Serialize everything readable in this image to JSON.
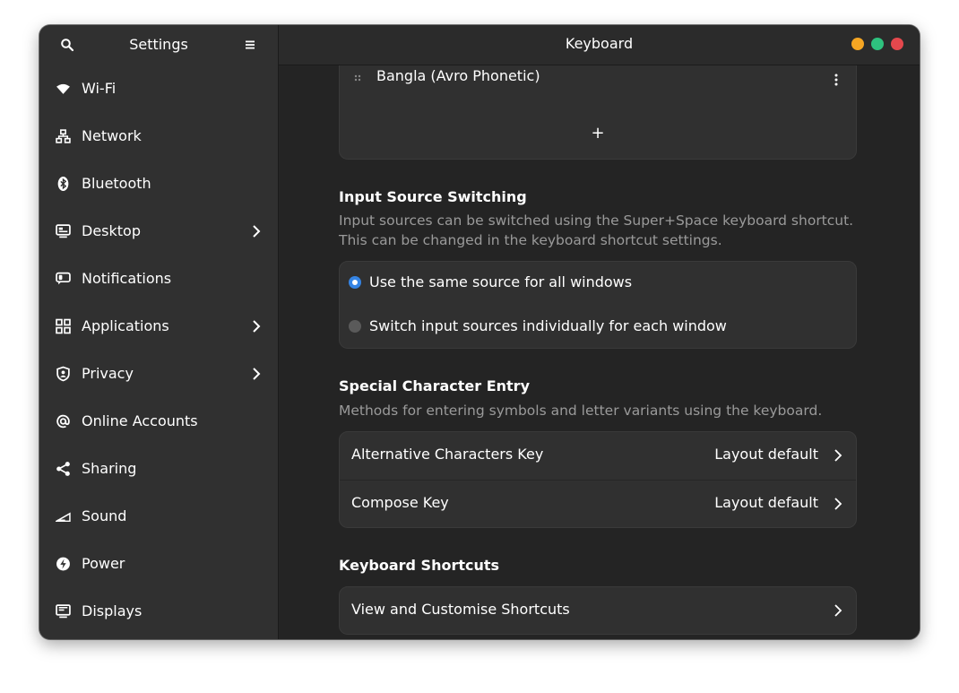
{
  "sidebar": {
    "title": "Settings",
    "items": [
      {
        "label": "Wi-Fi"
      },
      {
        "label": "Network"
      },
      {
        "label": "Bluetooth"
      },
      {
        "label": "Desktop"
      },
      {
        "label": "Notifications"
      },
      {
        "label": "Applications"
      },
      {
        "label": "Privacy"
      },
      {
        "label": "Online Accounts"
      },
      {
        "label": "Sharing"
      },
      {
        "label": "Sound"
      },
      {
        "label": "Power"
      },
      {
        "label": "Displays"
      }
    ]
  },
  "main": {
    "title": "Keyboard",
    "input_sources": {
      "partial_item": "Bangla (Avro Phonetic)",
      "add_label": "+"
    },
    "input_source_switching": {
      "title": "Input Source Switching",
      "description": "Input sources can be switched using the Super+Space keyboard shortcut. This can be changed in the keyboard shortcut settings.",
      "options": [
        {
          "label": "Use the same source for all windows",
          "selected": true
        },
        {
          "label": "Switch input sources individually for each window",
          "selected": false
        }
      ]
    },
    "special_character_entry": {
      "title": "Special Character Entry",
      "description": "Methods for entering symbols and letter variants using the keyboard.",
      "rows": [
        {
          "label": "Alternative Characters Key",
          "value": "Layout default"
        },
        {
          "label": "Compose Key",
          "value": "Layout default"
        }
      ]
    },
    "keyboard_shortcuts": {
      "title": "Keyboard Shortcuts",
      "row_label": "View and Customise Shortcuts"
    }
  },
  "colors": {
    "accent": "#3584e4",
    "window_bg": "#242424",
    "sidebar_bg": "#303030",
    "card_bg": "#303030",
    "minimize": "#f5a623",
    "maximize": "#2ec27e",
    "close": "#e5484d"
  }
}
